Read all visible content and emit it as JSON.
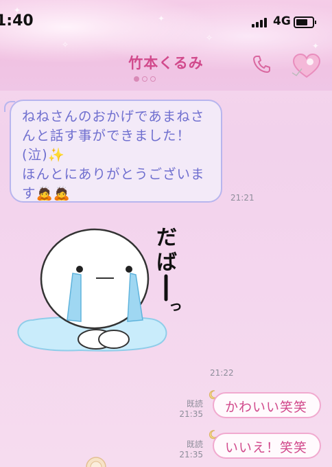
{
  "status_bar": {
    "time": "1:40",
    "network": "4G"
  },
  "header": {
    "contact_name": "竹本くるみ"
  },
  "messages": {
    "incoming_text": {
      "lines": [
        "ねねさんのおかげであまねさ",
        "んと話す事ができました！",
        "(泣)✨",
        "ほんとにありがとうございま",
        "す🙇🙇"
      ],
      "time": "21:21"
    },
    "incoming_sticker": {
      "caption": "だばーっ",
      "time": "21:22"
    },
    "outgoing": [
      {
        "text": "かわいい笑笑",
        "read": "既読",
        "time": "21:35"
      },
      {
        "text": "いいえ！笑笑",
        "read": "既読",
        "time": "21:35"
      }
    ]
  },
  "colors": {
    "accent": "#d14a8c",
    "incoming_text": "#6f6fcf",
    "incoming_border": "#b7b5ee",
    "outgoing_border": "#f1a9cf"
  }
}
